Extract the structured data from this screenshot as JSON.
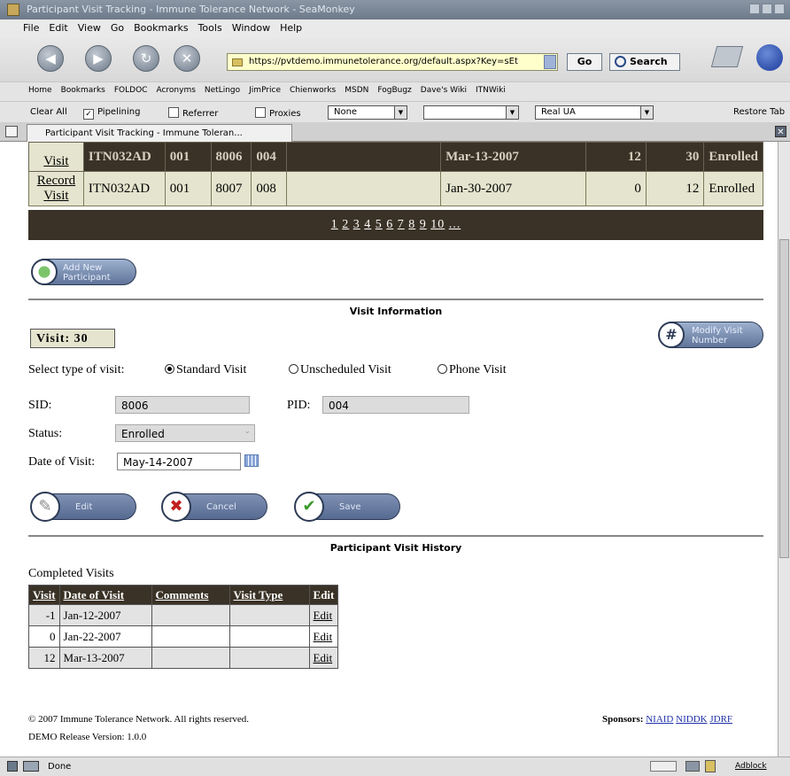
{
  "window": {
    "title": "Participant Visit Tracking - Immune Tolerance Network - SeaMonkey"
  },
  "menu": [
    "File",
    "Edit",
    "View",
    "Go",
    "Bookmarks",
    "Tools",
    "Window",
    "Help"
  ],
  "nav": {
    "url": "https://pvtdemo.immunetolerance.org/default.aspx?Key=sEt",
    "go_label": "Go",
    "search_label": "Search"
  },
  "bookmarks": [
    "Home",
    "Bookmarks",
    "FOLDOC",
    "Acronyms",
    "NetLingo",
    "JimPrice",
    "Chienworks",
    "MSDN",
    "FogBugz",
    "Dave's Wiki",
    "ITNWiki"
  ],
  "webdev": {
    "clear_all": "Clear All",
    "pipelining": "Pipelining",
    "referrer": "Referrer",
    "proxies": "Proxies",
    "proxy_value": "None",
    "blank_value": "",
    "ua_value": "Real UA",
    "restore": "Restore Tab"
  },
  "tab": {
    "label": "Participant Visit Tracking - Immune Toleran..."
  },
  "participants": {
    "rows": [
      {
        "link": "Visit",
        "study": "ITN032AD",
        "site": "001",
        "sid": "8006",
        "pid": "004",
        "blank": "",
        "date": "Mar-13-2007",
        "n1": "12",
        "n2": "30",
        "status": "Enrolled"
      },
      {
        "link": "Record Visit",
        "study": "ITN032AD",
        "site": "001",
        "sid": "8007",
        "pid": "008",
        "blank": "",
        "date": "Jan-30-2007",
        "n1": "0",
        "n2": "12",
        "status": "Enrolled"
      }
    ],
    "pager": [
      "1",
      "2",
      "3",
      "4",
      "5",
      "6",
      "7",
      "8",
      "9",
      "10",
      "..."
    ]
  },
  "add_participant_label": "Add New Participant",
  "visit_info": {
    "heading": "Visit Information",
    "visit_label": "Visit:",
    "visit_number": "30",
    "modify_label": "Modify Visit Number",
    "type_label": "Select type of visit:",
    "types": [
      "Standard Visit",
      "Unscheduled Visit",
      "Phone Visit"
    ],
    "selected_type": "Standard Visit",
    "sid_label": "SID:",
    "sid_value": "8006",
    "pid_label": "PID:",
    "pid_value": "004",
    "status_label": "Status:",
    "status_value": "Enrolled",
    "date_label": "Date of Visit:",
    "date_value": "May-14-2007",
    "edit_label": "Edit",
    "cancel_label": "Cancel",
    "save_label": "Save"
  },
  "history": {
    "heading": "Participant Visit History",
    "subheading": "Completed Visits",
    "columns": [
      "Visit",
      "Date of Visit",
      "Comments",
      "Visit Type",
      "Edit"
    ],
    "rows": [
      {
        "visit": "-1",
        "date": "Jan-12-2007",
        "comments": "",
        "type": "",
        "edit": "Edit"
      },
      {
        "visit": "0",
        "date": "Jan-22-2007",
        "comments": "",
        "type": "",
        "edit": "Edit"
      },
      {
        "visit": "12",
        "date": "Mar-13-2007",
        "comments": "",
        "type": "",
        "edit": "Edit"
      }
    ]
  },
  "footer": {
    "copyright": "© 2007 Immune Tolerance Network. All rights reserved.",
    "release": "DEMO Release Version: 1.0.0",
    "sponsors_label": "Sponsors:",
    "sponsors": [
      "NIAID",
      "NIDDK",
      "JDRF"
    ]
  },
  "status": {
    "text": "Done",
    "adblock": "Adblock"
  }
}
